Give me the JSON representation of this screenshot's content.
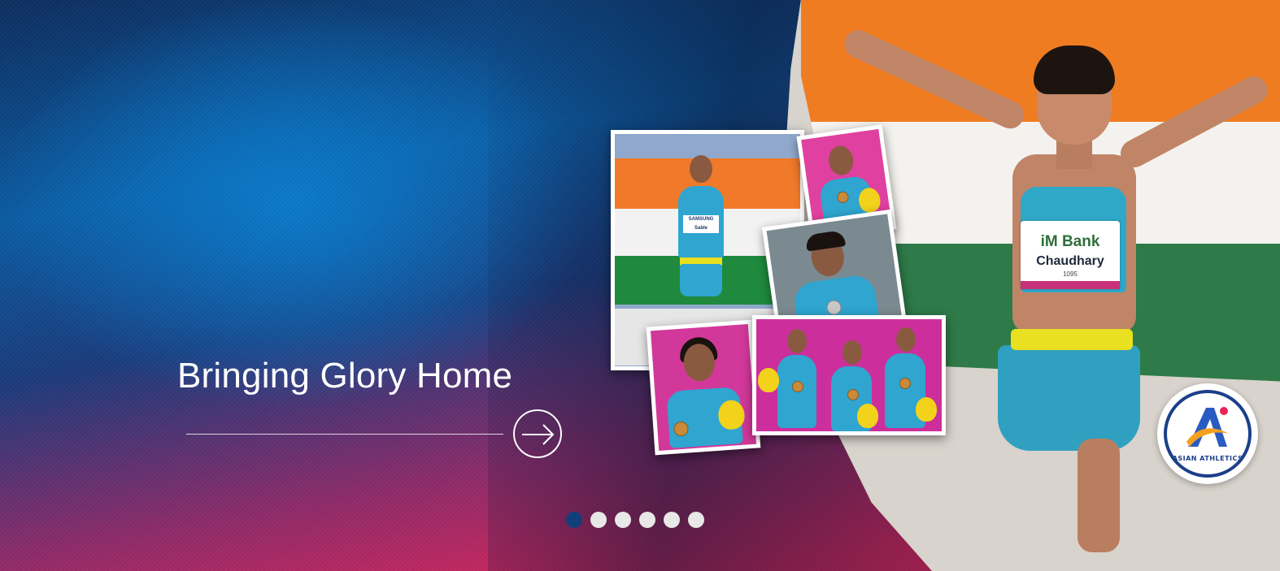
{
  "slide": {
    "headline": "Bringing Glory Home",
    "cta_icon": "arrow-right-circle-icon"
  },
  "carousel": {
    "total_slides": 6,
    "active_index": 0,
    "active_color": "#123f7a",
    "inactive_color": "#e8e8e8"
  },
  "hero_image": {
    "bib_sponsor": "iM Bank",
    "bib_name": "Chaudhary",
    "bib_number": "1095"
  },
  "collage": {
    "photo1_bib_sponsor": "SAMSUNG",
    "photo1_bib_name": "Sable"
  },
  "logo": {
    "text": "ASIAN ATHLETICS",
    "icon": "asian-athletics-logo"
  },
  "colors": {
    "primary_blue": "#0b5aa0",
    "accent_pink": "#e8245a",
    "saffron": "#f07c22",
    "green": "#2e7a48"
  }
}
